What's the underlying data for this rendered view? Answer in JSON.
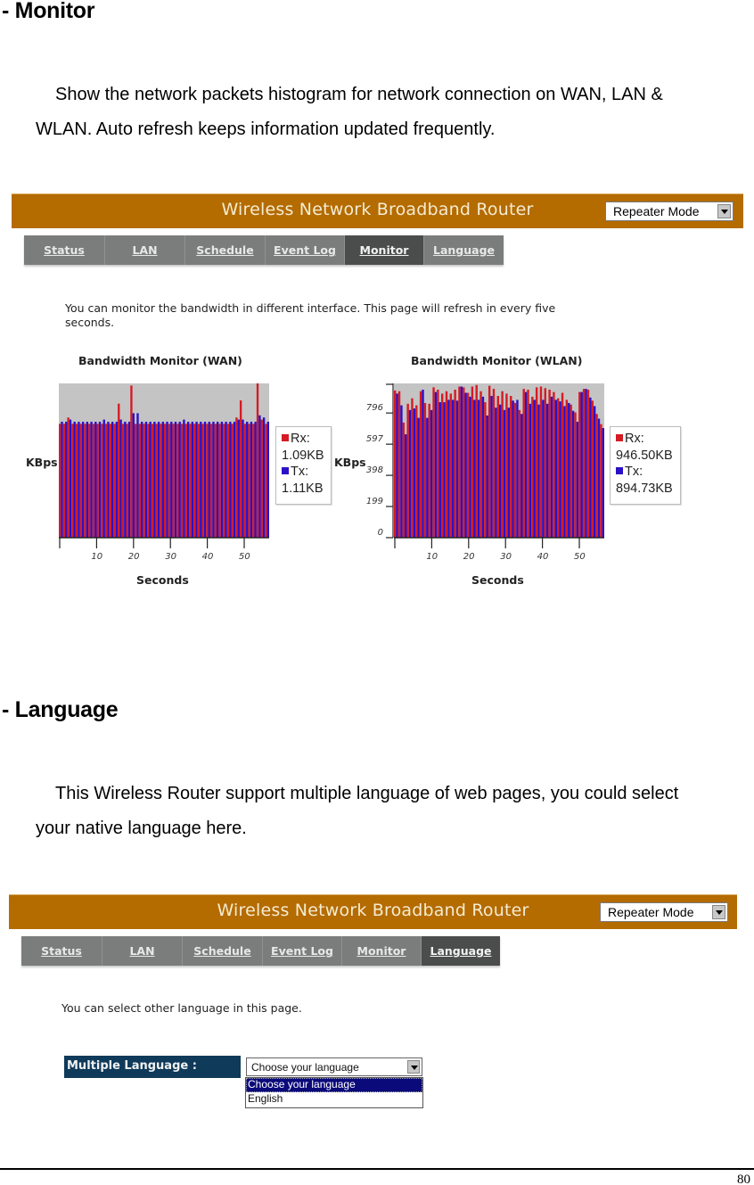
{
  "monitor_section": {
    "heading": "- Monitor",
    "description_line1": "Show the network packets histogram for network connection on WAN, LAN &",
    "description_line2": "WLAN. Auto refresh keeps information updated frequently."
  },
  "language_section": {
    "heading": "- Language",
    "description_line1": "This Wireless Router support multiple language of web pages, you could select",
    "description_line2": "your native language here."
  },
  "router_ui": {
    "title": "Wireless Network Broadband Router",
    "mode_select_value": "Repeater Mode",
    "tabs": [
      {
        "label": "Status"
      },
      {
        "label": "LAN"
      },
      {
        "label": "Schedule"
      },
      {
        "label": "Event Log"
      },
      {
        "label": "Monitor"
      },
      {
        "label": "Language"
      }
    ],
    "colors": {
      "banner": "#b46b00",
      "tab_bar": "#7b7d7d",
      "tab_active": "#4b4c4c",
      "rx": "#d41c24",
      "tx": "#2a10c8",
      "plot_bg": "#c4c4c4",
      "lang_label_bg": "#0f3a5a"
    }
  },
  "monitor_page": {
    "active_tab": "Monitor",
    "note_line1": "You can monitor the bandwidth in different interface. This page will refresh in every five",
    "note_line2": "seconds."
  },
  "language_page": {
    "active_tab": "Language",
    "note": "You can select other language in this page.",
    "field_label": "Multiple Language :",
    "select_value": "Choose your language",
    "options": [
      {
        "label": "Choose your language",
        "selected": true
      },
      {
        "label": "English",
        "selected": false
      }
    ]
  },
  "chart_data": [
    {
      "type": "bar",
      "title": "Bandwidth Monitor (WAN)",
      "xlabel": "Seconds",
      "ylabel": "KBps",
      "x_ticks": [
        "10",
        "20",
        "30",
        "40",
        "50"
      ],
      "y_ticks": [],
      "xlim": [
        0,
        57
      ],
      "ylim": [
        0,
        1.45
      ],
      "legend": {
        "position": "right",
        "entries": [
          {
            "name": "Rx:",
            "value": "1.09KB"
          },
          {
            "name": "Tx:",
            "value": "1.11KB"
          }
        ]
      },
      "series": [
        {
          "name": "Rx",
          "values": [
            1.07,
            1.07,
            1.13,
            1.07,
            1.07,
            1.07,
            1.07,
            1.07,
            1.07,
            1.07,
            1.07,
            1.07,
            1.07,
            1.07,
            1.26,
            1.07,
            1.07,
            1.43,
            1.07,
            1.07,
            1.07,
            1.07,
            1.07,
            1.07,
            1.07,
            1.07,
            1.07,
            1.07,
            1.07,
            1.07,
            1.07,
            1.07,
            1.07,
            1.07,
            1.07,
            1.07,
            1.07,
            1.07,
            1.07,
            1.07,
            1.07,
            1.07,
            1.13,
            1.29,
            1.07,
            1.07,
            1.07,
            1.45,
            1.11,
            1.07
          ]
        },
        {
          "name": "Tx",
          "values": [
            1.09,
            1.09,
            1.11,
            1.09,
            1.09,
            1.09,
            1.09,
            1.09,
            1.09,
            1.09,
            1.11,
            1.09,
            1.09,
            1.09,
            1.11,
            1.09,
            1.09,
            1.17,
            1.17,
            1.09,
            1.09,
            1.09,
            1.09,
            1.09,
            1.09,
            1.09,
            1.09,
            1.09,
            1.09,
            1.11,
            1.09,
            1.09,
            1.09,
            1.09,
            1.09,
            1.09,
            1.09,
            1.09,
            1.09,
            1.09,
            1.09,
            1.09,
            1.11,
            1.11,
            1.09,
            1.09,
            1.09,
            1.15,
            1.13,
            1.09
          ]
        }
      ]
    },
    {
      "type": "bar",
      "title": "Bandwidth Monitor (WLAN)",
      "xlabel": "Seconds",
      "ylabel": "KBps",
      "x_ticks": [
        "10",
        "20",
        "30",
        "40",
        "50"
      ],
      "y_ticks": [
        "0",
        "199",
        "398",
        "597",
        "796"
      ],
      "xlim": [
        0,
        57
      ],
      "ylim": [
        0,
        985
      ],
      "legend": {
        "position": "right",
        "entries": [
          {
            "name": "Rx:",
            "value": "946.50KB"
          },
          {
            "name": "Tx:",
            "value": "894.73KB"
          }
        ]
      },
      "series": [
        {
          "name": "Rx",
          "values": [
            940,
            935,
            735,
            855,
            890,
            845,
            935,
            860,
            855,
            960,
            945,
            920,
            935,
            920,
            945,
            965,
            960,
            925,
            965,
            975,
            935,
            865,
            970,
            950,
            905,
            935,
            920,
            905,
            860,
            815,
            950,
            945,
            900,
            960,
            965,
            955,
            945,
            930,
            890,
            925,
            880,
            850,
            800,
            930,
            950,
            945,
            875,
            790,
            725
          ]
        },
        {
          "name": "Tx",
          "values": [
            920,
            845,
            660,
            815,
            825,
            765,
            945,
            765,
            815,
            930,
            865,
            865,
            880,
            880,
            875,
            965,
            925,
            900,
            880,
            880,
            900,
            780,
            905,
            830,
            850,
            815,
            830,
            875,
            880,
            790,
            930,
            855,
            880,
            850,
            880,
            855,
            900,
            880,
            870,
            840,
            860,
            810,
            740,
            930,
            950,
            895,
            840,
            760,
            700
          ]
        }
      ]
    }
  ],
  "footer": {
    "page_number": "80"
  }
}
